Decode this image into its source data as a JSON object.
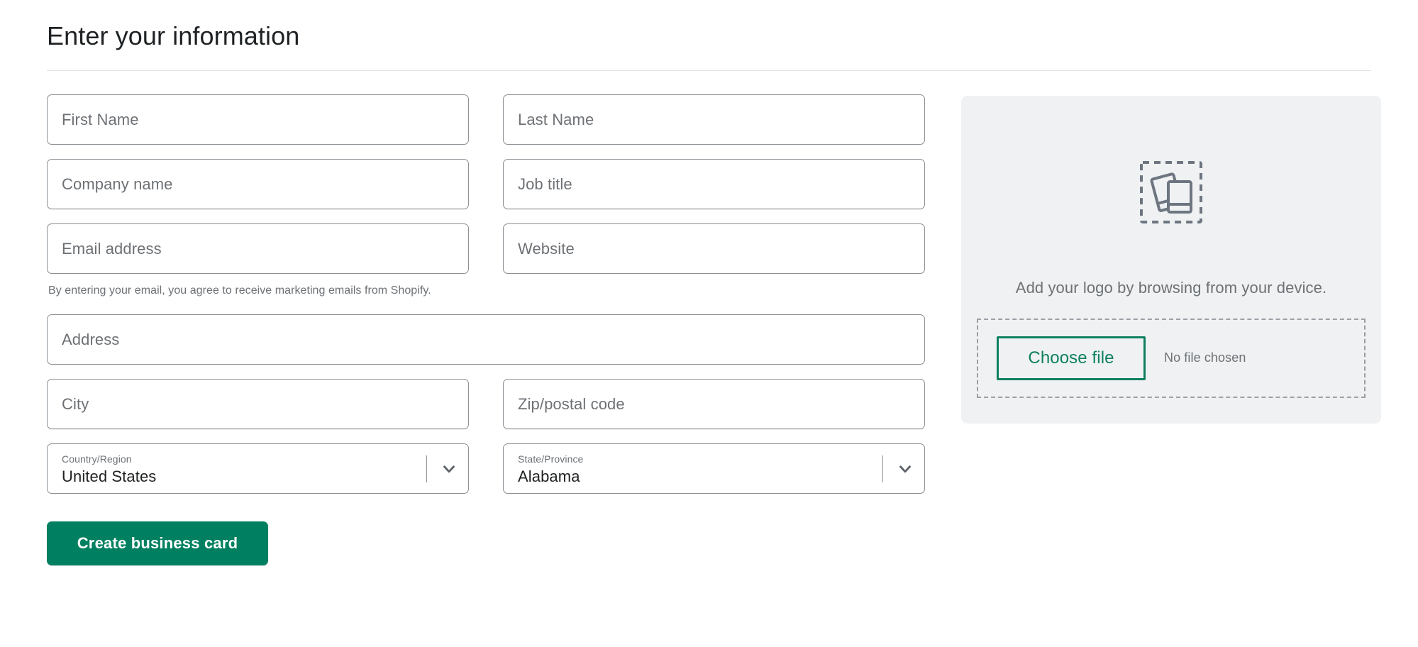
{
  "header": {
    "title": "Enter your information"
  },
  "form": {
    "fields": {
      "first_name": {
        "placeholder": "First Name",
        "value": ""
      },
      "last_name": {
        "placeholder": "Last Name",
        "value": ""
      },
      "company_name": {
        "placeholder": "Company name",
        "value": ""
      },
      "job_title": {
        "placeholder": "Job title",
        "value": ""
      },
      "email_address": {
        "placeholder": "Email address",
        "value": ""
      },
      "website": {
        "placeholder": "Website",
        "value": ""
      },
      "address": {
        "placeholder": "Address",
        "value": ""
      },
      "city": {
        "placeholder": "City",
        "value": ""
      },
      "zip": {
        "placeholder": "Zip/postal code",
        "value": ""
      }
    },
    "marketing_disclaimer": "By entering your email, you agree to receive marketing emails from Shopify.",
    "country": {
      "label": "Country/Region",
      "value": "United States"
    },
    "state": {
      "label": "State/Province",
      "value": "Alabama"
    },
    "submit_label": "Create business card"
  },
  "logo_panel": {
    "caption": "Add your logo by browsing from your device.",
    "choose_file_label": "Choose file",
    "no_file_text": "No file chosen",
    "icon": "images-placeholder-icon"
  },
  "colors": {
    "primary_green": "#008060",
    "outline_green": "#0e8060",
    "panel_background": "#eff1f2",
    "field_border": "#8c9196",
    "placeholder_text": "#6d7175",
    "divider": "#e1e3e5",
    "icon_gray": "#6d7680"
  }
}
